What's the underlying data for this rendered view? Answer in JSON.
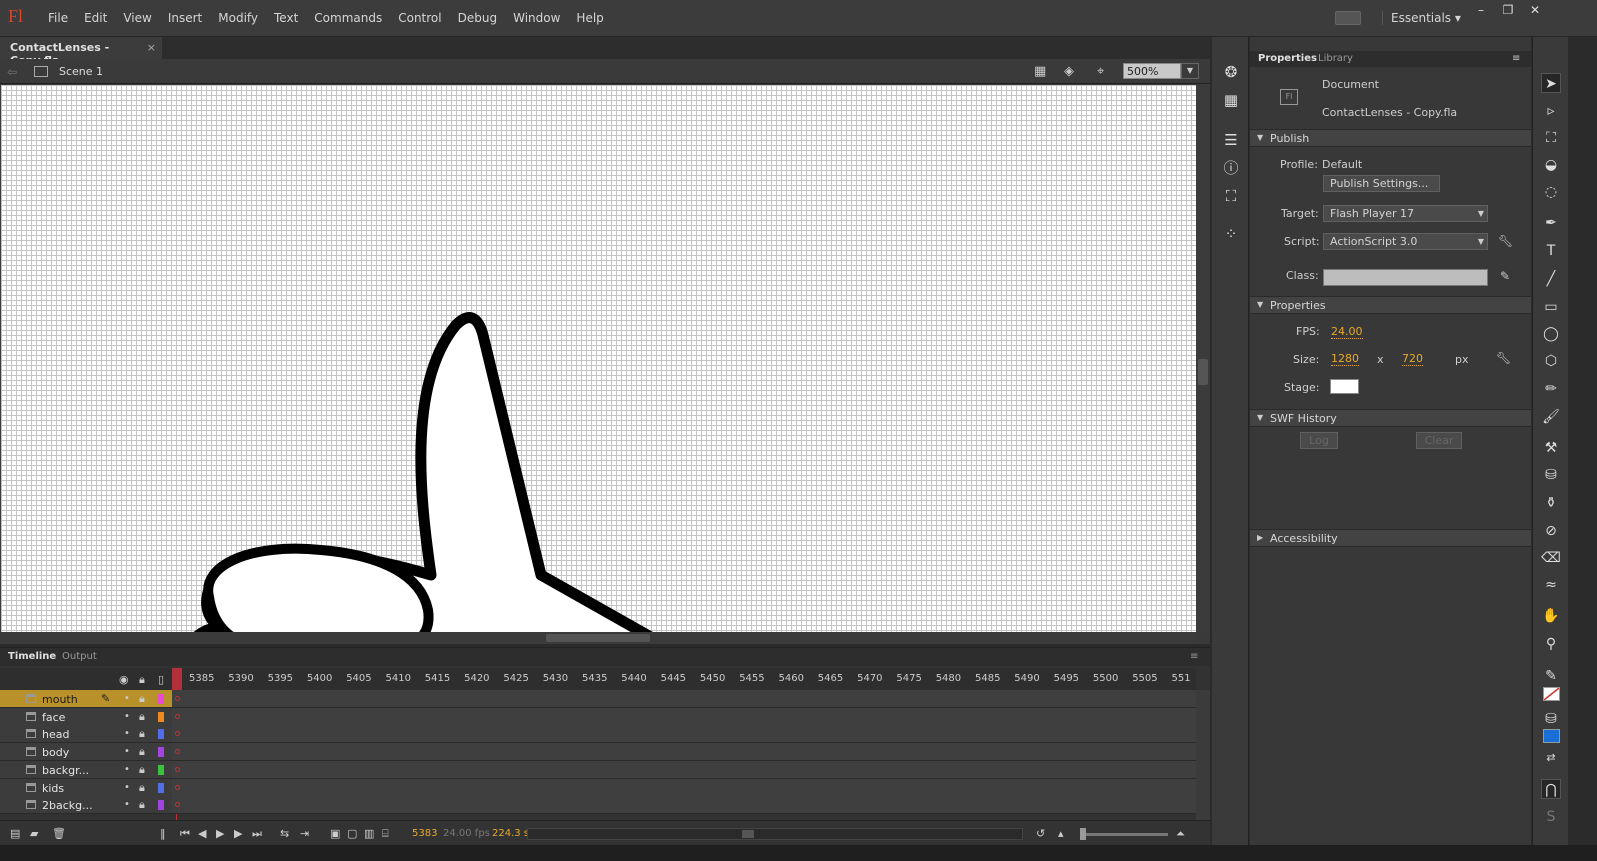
{
  "app": {
    "logo": "Fl",
    "menus": [
      "File",
      "Edit",
      "View",
      "Insert",
      "Modify",
      "Text",
      "Commands",
      "Control",
      "Debug",
      "Window",
      "Help"
    ],
    "workspace": "Essentials",
    "window_controls": [
      "minimize",
      "restore",
      "close"
    ]
  },
  "document": {
    "tab_label": "ContactLenses - Copy.fla",
    "close_glyph": "×"
  },
  "editbar": {
    "scene": "Scene 1",
    "zoom": "500%"
  },
  "timeline": {
    "tabs": [
      "Timeline",
      "Output"
    ],
    "frame_numbers": [
      "5385",
      "5390",
      "5395",
      "5400",
      "5405",
      "5410",
      "5415",
      "5420",
      "5425",
      "5430",
      "5435",
      "5440",
      "5445",
      "5450",
      "5455",
      "5460",
      "5465",
      "5470",
      "5475",
      "5480",
      "5485",
      "5490",
      "5495",
      "5500",
      "5505",
      "551"
    ],
    "layers": [
      {
        "name": "mouth",
        "color": "#e64bd0",
        "active": true
      },
      {
        "name": "face",
        "color": "#f08a1c",
        "active": false
      },
      {
        "name": "head",
        "color": "#4f6ee8",
        "active": false
      },
      {
        "name": "body",
        "color": "#a245e0",
        "active": false
      },
      {
        "name": "backgr...",
        "color": "#3ac23a",
        "active": false
      },
      {
        "name": "kids",
        "color": "#4f6ee8",
        "active": false
      },
      {
        "name": "2backg...",
        "color": "#a245e0",
        "active": false
      }
    ],
    "footer": {
      "current_frame": "5383",
      "fps": "24.00 fps",
      "elapsed": "224.3 s"
    }
  },
  "properties_panel": {
    "tabs": [
      "Properties",
      "Library"
    ],
    "doc_type": "Document",
    "doc_icon": "Fl",
    "doc_name": "ContactLenses - Copy.fla",
    "publish": {
      "header": "Publish",
      "profile_label": "Profile:",
      "profile_value": "Default",
      "settings_button": "Publish Settings...",
      "target_label": "Target:",
      "target_value": "Flash Player 17",
      "script_label": "Script:",
      "script_value": "ActionScript 3.0",
      "class_label": "Class:"
    },
    "properties": {
      "header": "Properties",
      "fps_label": "FPS:",
      "fps_value": "24.00",
      "size_label": "Size:",
      "width": "1280",
      "x": "x",
      "height": "720",
      "unit": "px",
      "stage_label": "Stage:",
      "stage_color": "#ffffff"
    },
    "swf_history": {
      "header": "SWF History",
      "log_button": "Log",
      "clear_button": "Clear"
    },
    "accessibility": {
      "header": "Accessibility"
    }
  },
  "colors": {
    "stroke_color": "#ffffff",
    "fill_color": "#1a6fd6",
    "accent": "#e8a92b",
    "active_layer": "#b8912b"
  }
}
